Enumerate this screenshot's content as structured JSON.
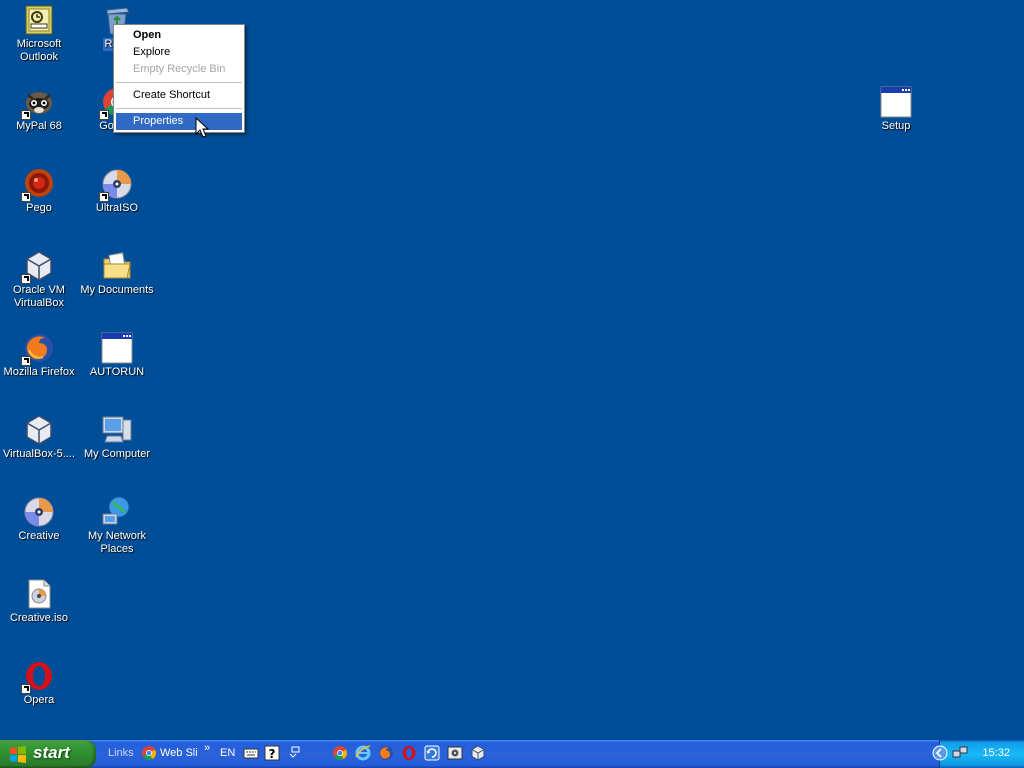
{
  "desktop": {
    "background_color": "#004e98",
    "icons": {
      "outlook": {
        "label": "Microsoft Outlook",
        "icon": "outlook-icon"
      },
      "recycle_bin": {
        "label": "Recy",
        "icon": "recycle-bin-icon"
      },
      "mypal": {
        "label": "MyPal 68",
        "icon": "raccoon-icon"
      },
      "google_chrome": {
        "label": "Google",
        "icon": "chrome-icon"
      },
      "pego": {
        "label": "Pego",
        "icon": "pego-icon"
      },
      "ultraiso": {
        "label": "UltraISO",
        "icon": "disc-icon"
      },
      "oracle_vm": {
        "label": "Oracle VM VirtualBox",
        "icon": "virtualbox-icon"
      },
      "my_documents": {
        "label": "My Documents",
        "icon": "folder-documents-icon"
      },
      "firefox": {
        "label": "Mozilla Firefox",
        "icon": "firefox-icon"
      },
      "autorun": {
        "label": "AUTORUN",
        "icon": "window-icon"
      },
      "virtualbox5": {
        "label": "VirtualBox-5....",
        "icon": "virtualbox-icon"
      },
      "my_computer": {
        "label": "My Computer",
        "icon": "computer-icon"
      },
      "creative": {
        "label": "Creative",
        "icon": "disc-icon"
      },
      "my_network": {
        "label": "My Network Places",
        "icon": "network-icon"
      },
      "creative_iso": {
        "label": "Creative.iso",
        "icon": "iso-file-icon"
      },
      "opera": {
        "label": "Opera",
        "icon": "opera-icon"
      },
      "setup": {
        "label": "Setup",
        "icon": "window-icon"
      }
    }
  },
  "context_menu": {
    "open": "Open",
    "explore": "Explore",
    "empty_recycle_bin": "Empty Recycle Bin",
    "create_shortcut": "Create Shortcut",
    "properties": "Properties",
    "highlighted": "Properties"
  },
  "taskbar": {
    "start_label": "start",
    "links_label": "Links",
    "web_slice_label": "Web Sli",
    "chevron": "»",
    "language": "EN",
    "quick_launch": [
      "chrome-icon",
      "ie-icon",
      "firefox-icon",
      "opera-icon",
      "update-icon",
      "media-icon",
      "virtualbox-icon"
    ],
    "clock": "15:32"
  }
}
